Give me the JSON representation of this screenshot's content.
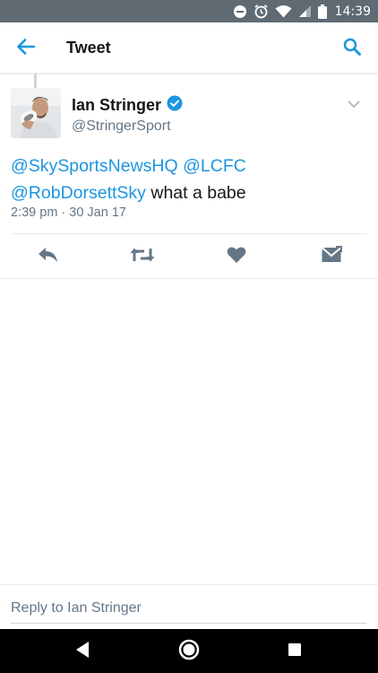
{
  "status_bar": {
    "time": "14:39",
    "icons": [
      "do-not-disturb-icon",
      "alarm-icon",
      "wifi-icon",
      "cell-signal-icon",
      "battery-icon"
    ]
  },
  "app_bar": {
    "title": "Tweet",
    "back_icon": "arrow-left-icon",
    "search_icon": "search-icon"
  },
  "tweet": {
    "author_name": "Ian Stringer",
    "verified": true,
    "author_handle": "@StringerSport",
    "mentions": [
      "@SkySportsNewsHQ",
      "@LCFC",
      "@RobDorsettSky"
    ],
    "text_after_mentions": "what a babe",
    "timestamp": "2:39 pm · 30 Jan 17",
    "actions": [
      "reply-icon",
      "retweet-icon",
      "like-icon",
      "direct-message-icon"
    ]
  },
  "reply": {
    "placeholder": "Reply to Ian Stringer"
  },
  "nav_bar": {
    "buttons": [
      "back-triangle-icon",
      "home-circle-icon",
      "recents-square-icon"
    ]
  },
  "colors": {
    "accent": "#1b95e0",
    "status_bar": "#5f6a73",
    "secondary_text": "#657786",
    "icon_gray": "#657786"
  }
}
